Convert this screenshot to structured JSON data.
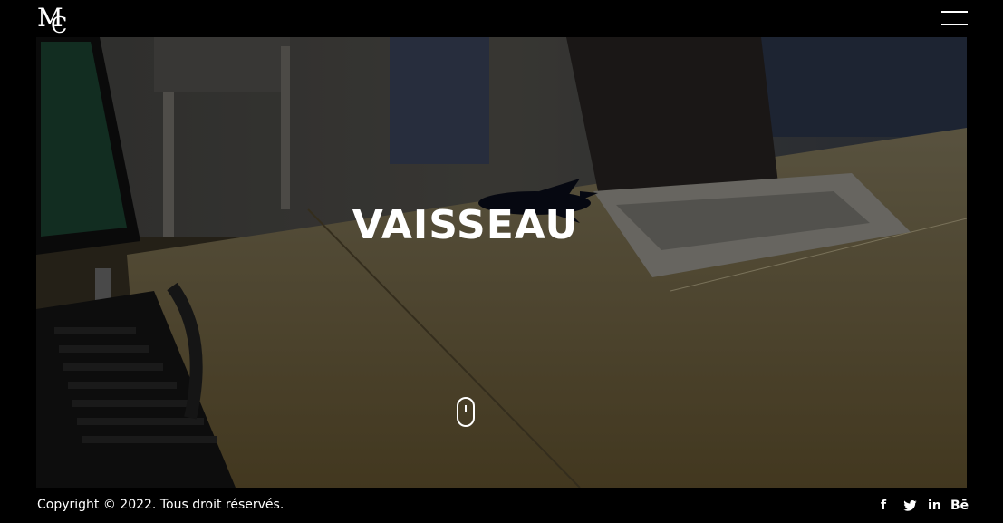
{
  "header": {
    "logo_icon": "mc-monogram-logo",
    "menu_icon": "hamburger-menu-icon"
  },
  "hero": {
    "title": "VAISSEAU",
    "scroll_icon": "mouse-scroll-icon"
  },
  "footer": {
    "copyright": "Copyright © 2022. Tous droit réservés.",
    "social": [
      {
        "icon": "facebook-icon",
        "label": "f"
      },
      {
        "icon": "twitter-icon",
        "label": ""
      },
      {
        "icon": "linkedin-icon",
        "label": "in"
      },
      {
        "icon": "behance-icon",
        "label": "Bē"
      }
    ]
  },
  "colors": {
    "background": "#000000",
    "text": "#ffffff"
  }
}
